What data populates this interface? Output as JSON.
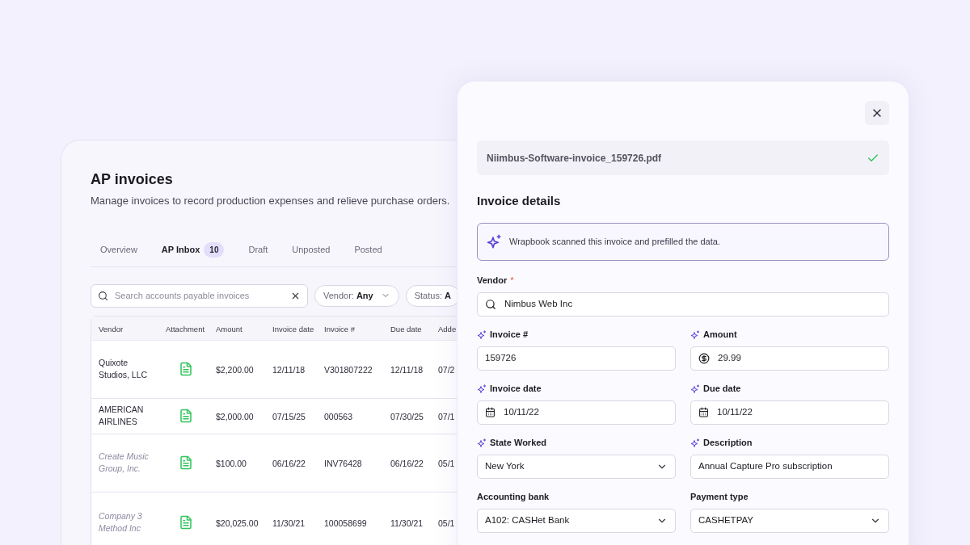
{
  "list_page": {
    "title": "AP invoices",
    "subtitle": "Manage invoices to record production expenses and relieve purchase orders.",
    "tabs": [
      {
        "label": "Overview",
        "selected": false
      },
      {
        "label": "AP Inbox",
        "count": "10",
        "selected": true
      },
      {
        "label": "Draft",
        "selected": false
      },
      {
        "label": "Unposted",
        "selected": false
      },
      {
        "label": "Posted",
        "selected": false
      }
    ],
    "search": {
      "placeholder": "Search accounts payable invoices"
    },
    "filters": [
      {
        "label": "Vendor:",
        "value": "Any",
        "caret": true
      },
      {
        "label": "Status:",
        "value": "A",
        "caret": false
      }
    ],
    "table": {
      "columns": [
        "Vendor",
        "Attachment",
        "Amount",
        "Invoice date",
        "Invoice #",
        "Due date",
        "Adde"
      ],
      "rows": [
        {
          "vendor": "Quixote Studios, LLC",
          "faded": false,
          "amount": "$2,200.00",
          "invoice_date": "12/11/18",
          "invoice_number": "V301807222",
          "due_date": "12/11/18",
          "added": "07/2"
        },
        {
          "vendor": "AMERICAN AIRLINES",
          "faded": false,
          "amount": "$2,000.00",
          "invoice_date": "07/15/25",
          "invoice_number": "000563",
          "due_date": "07/30/25",
          "added": "07/1"
        },
        {
          "vendor": "Create Music Group, Inc.",
          "faded": true,
          "amount": "$100.00",
          "invoice_date": "06/16/22",
          "invoice_number": "INV76428",
          "due_date": "06/16/22",
          "added": "05/1"
        },
        {
          "vendor": "Company 3 Method Inc",
          "faded": true,
          "amount": "$20,025.00",
          "invoice_date": "11/30/21",
          "invoice_number": "100058699",
          "due_date": "11/30/21",
          "added": "05/1"
        }
      ]
    }
  },
  "invoice_panel": {
    "file": {
      "name": "Niimbus-Software-invoice_159726.pdf",
      "verified": true
    },
    "heading": "Invoice details",
    "notice": "Wrapbook scanned this invoice and prefilled the data.",
    "fields": [
      {
        "label": "Vendor",
        "kind": "search",
        "value": "Nimbus Web Inc",
        "required_mark": "*",
        "prefilled": false,
        "wide": true
      },
      {
        "label": "Invoice #",
        "kind": "text",
        "value": "159726",
        "prefilled": true,
        "wide": false
      },
      {
        "label": "Amount",
        "kind": "currency",
        "value": "29.99",
        "prefilled": true,
        "wide": false
      },
      {
        "label": "Invoice date",
        "kind": "date",
        "value": "10/11/22",
        "prefilled": true,
        "wide": false
      },
      {
        "label": "Due date",
        "kind": "date",
        "value": "10/11/22",
        "prefilled": true,
        "wide": false
      },
      {
        "label": "State Worked",
        "kind": "select",
        "value": "New York",
        "prefilled": true,
        "wide": false
      },
      {
        "label": "Description",
        "kind": "text",
        "value": "Annual Capture Pro subscription",
        "prefilled": true,
        "wide": false
      },
      {
        "label": "Accounting bank",
        "kind": "select",
        "value": "A102: CASHet Bank",
        "prefilled": false,
        "wide": false
      },
      {
        "label": "Payment type",
        "kind": "select",
        "value": "CASHETPAY",
        "prefilled": false,
        "wide": false
      }
    ]
  }
}
